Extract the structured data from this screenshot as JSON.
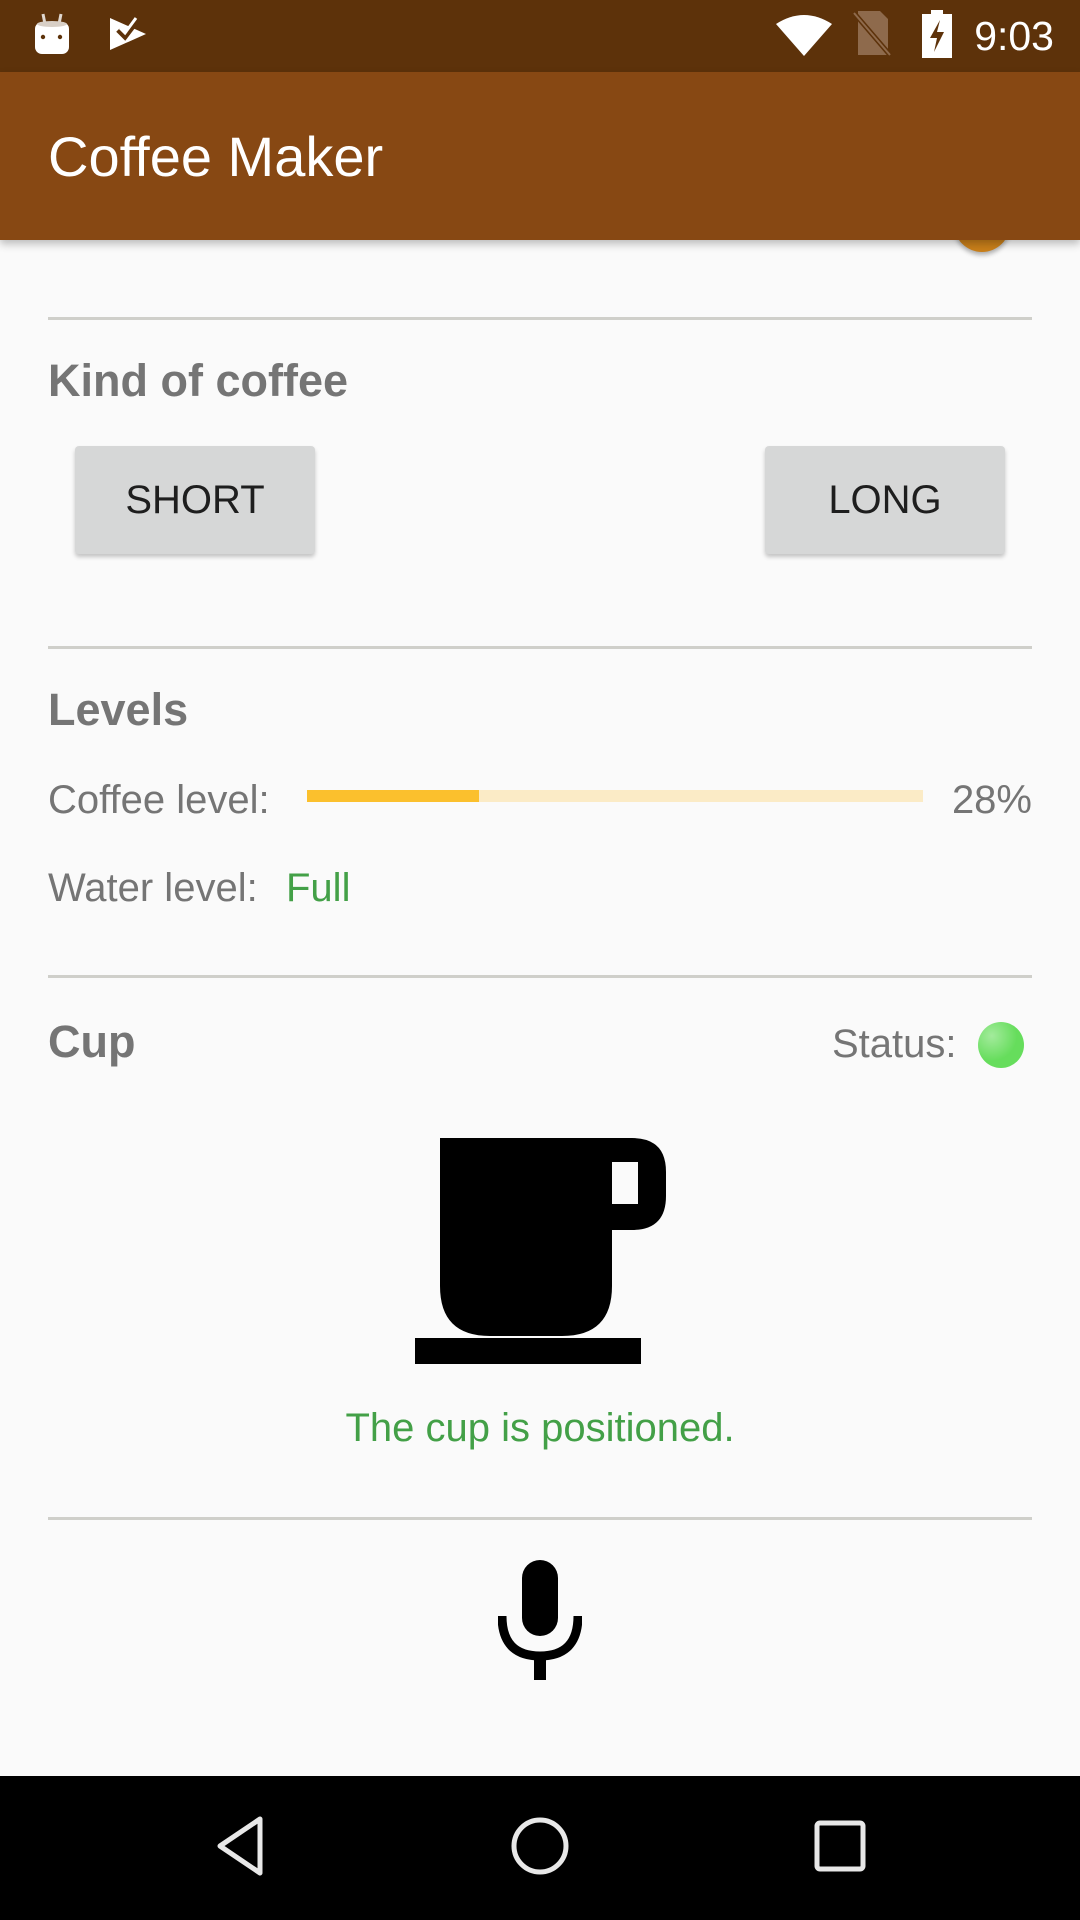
{
  "status_bar": {
    "time": "9:03",
    "left_icons": [
      "android-notification-icon",
      "task-check-icon"
    ],
    "right_icons": [
      "wifi-icon",
      "no-sim-icon",
      "battery-charging-icon"
    ]
  },
  "app_bar": {
    "title": "Coffee Maker"
  },
  "kind_of_coffee": {
    "title": "Kind of coffee",
    "buttons": [
      {
        "label": "SHORT"
      },
      {
        "label": "LONG"
      }
    ]
  },
  "levels": {
    "title": "Levels",
    "coffee_label": "Coffee level:",
    "coffee_percent": 28,
    "coffee_percent_text": "28%",
    "water_label": "Water level:",
    "water_value": "Full"
  },
  "cup": {
    "title": "Cup",
    "status_label": "Status:",
    "status_color": "#66dd5c",
    "message": "The cup is positioned."
  },
  "colors": {
    "status_bar": "#5d320a",
    "app_bar": "#874813",
    "progress_fill": "#fbc02d",
    "progress_track": "#fbebc6",
    "success_text": "#43a047"
  },
  "nav_bar": {
    "buttons": [
      "back",
      "home",
      "recents"
    ]
  }
}
